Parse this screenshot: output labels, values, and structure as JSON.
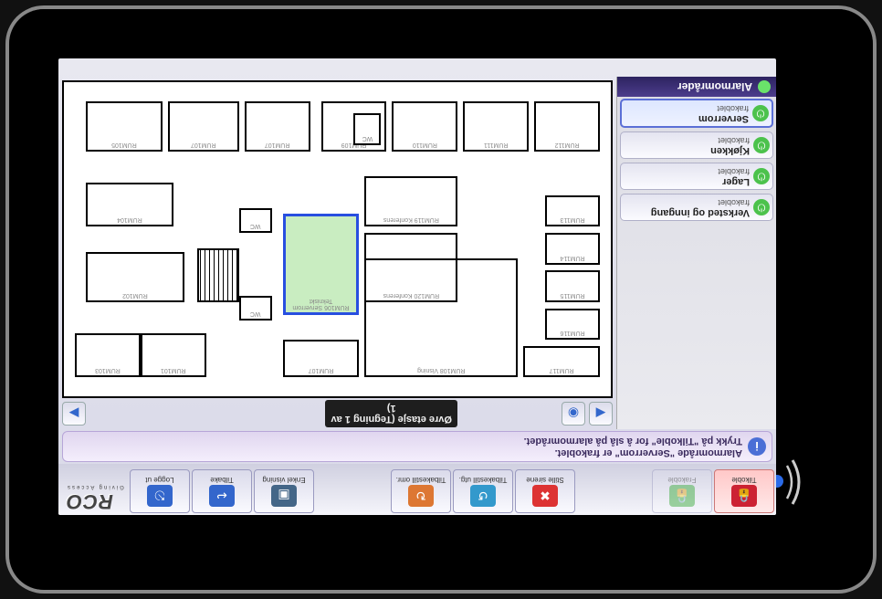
{
  "brand": {
    "name": "RCO",
    "tagline": "Giving Access"
  },
  "toolbar": {
    "tilkoble": "Tilkoble",
    "frakoble": "Frakoble",
    "stille": "Stille sirene",
    "tilbakestill_utg": "Tilbakestill utg.",
    "tilbakestill_omr": "Tilbakestill omr.",
    "enkel": "Enkel visning",
    "tilbake": "Tilbake",
    "loggeut": "Logge ut"
  },
  "notice": {
    "line1": "Alarmområde \"Serverrom\" er frakoblet.",
    "line2": "Trykk på \"Tilkoble\" for å slå på alarmområdet."
  },
  "sidebar": {
    "header": "Alarmområder",
    "items": [
      {
        "name": "Verksted og inngang",
        "status": "frakoblet"
      },
      {
        "name": "Lager",
        "status": "frakoblet"
      },
      {
        "name": "Kjøkken",
        "status": "frakoblet"
      },
      {
        "name": "Serverrom",
        "status": "frakoblet"
      }
    ]
  },
  "plan": {
    "title": "Øvre etasje   (Tegning 1 av 1)",
    "rooms": {
      "r0": "RUM117",
      "r1": "RUM116",
      "r2": "RUM115",
      "r3": "RUM114",
      "r4": "RUM113",
      "r5": "RUM112",
      "r6": "RUM111",
      "r7": "RUM110",
      "r8": "RUM109",
      "r9": "RUM108 Visning",
      "r10": "RUM107",
      "r11": "RUM120 Konferens",
      "r12": "RUM119 Konferens",
      "r13": "RUM106 Serverrom Tekniskt",
      "r14": "RUM101",
      "r15": "RUM103",
      "r16": "RUM102",
      "r17": "RUM104",
      "r18": "RUM105",
      "wc1": "WC",
      "wc2": "WC",
      "wc3": "WC"
    }
  }
}
